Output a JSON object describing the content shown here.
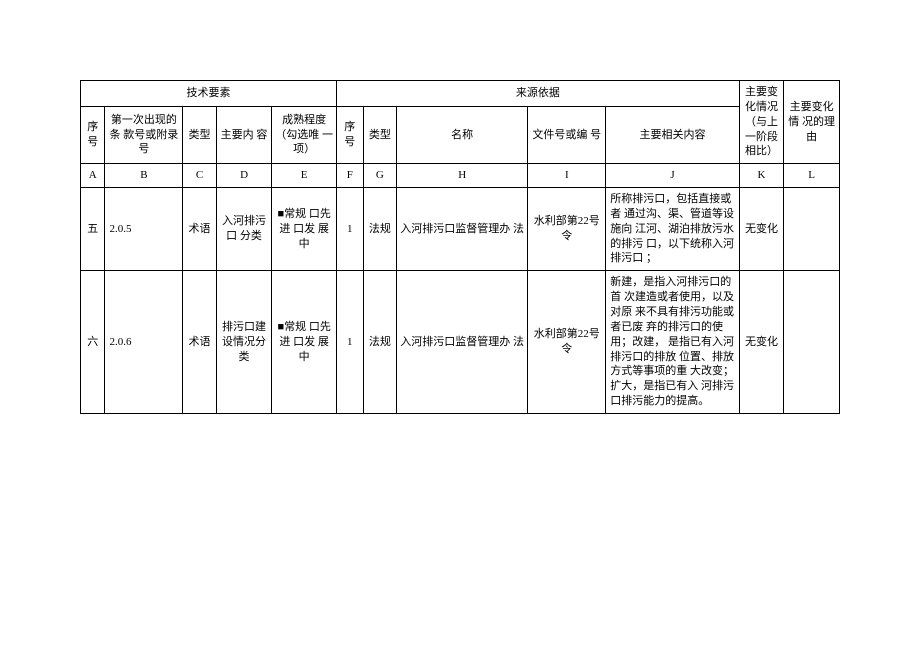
{
  "headers": {
    "group_tech": "技术要素",
    "group_source": "来源依据",
    "seq": "序 号",
    "first_occurrence": "第一次出现的 条 款号或附录 号",
    "type": "类型",
    "main_content": "主要内 容",
    "maturity": "成熟程度 （勾选唯 一 项）",
    "source_seq": "序号",
    "source_type": "类型",
    "source_name": "名称",
    "source_doc_no": "文件号或编 号",
    "source_main": "主要相关内容",
    "major_change": "主要变 化情况 （与上 一阶段 相比）",
    "change_reason": "主要变化 情 况的理 由",
    "letters": {
      "A": "A",
      "B": "B",
      "C": "C",
      "D": "D",
      "E": "E",
      "F": "F",
      "G": "G",
      "H": "H",
      "I": "I",
      "J": "J",
      "K": "K",
      "L": "L"
    }
  },
  "rows": [
    {
      "seq": "五",
      "clause": "2.0.5",
      "type": "术语",
      "content": "入河排污 口 分类",
      "maturity": "■常规 口先进 口发 展中",
      "src_seq": "1",
      "src_type": "法规",
      "src_name": "入河排污口监督管理办 法",
      "src_doc": "水利部第22号 令",
      "src_main": "所称排污口，包括直接或 者 通过沟、渠、管道等设 施向 江河、湖泊排放污水 的排污 口，以下统称入河 排污口 ；",
      "change": "无变化",
      "reason": ""
    },
    {
      "seq": "六",
      "clause": "2.0.6",
      "type": "术语",
      "content": "排污口建 设情况分 类",
      "maturity": "■常规 口先进 口发 展中",
      "src_seq": "1",
      "src_type": "法规",
      "src_name": "入河排污口监督管理办 法",
      "src_doc": "水利部第22号 令",
      "src_main": "新建，是指入河排污口的 首 次建造或者使用，以及 对原 来不具有排污功能或 者已废 弃的排污口的使 用；改建， 是指已有入河 排污口的排放 位置、排放 方式等事项的重 大改变； 扩大，是指已有入 河排污 口排污能力的提高。",
      "change": "无变化",
      "reason": ""
    }
  ]
}
